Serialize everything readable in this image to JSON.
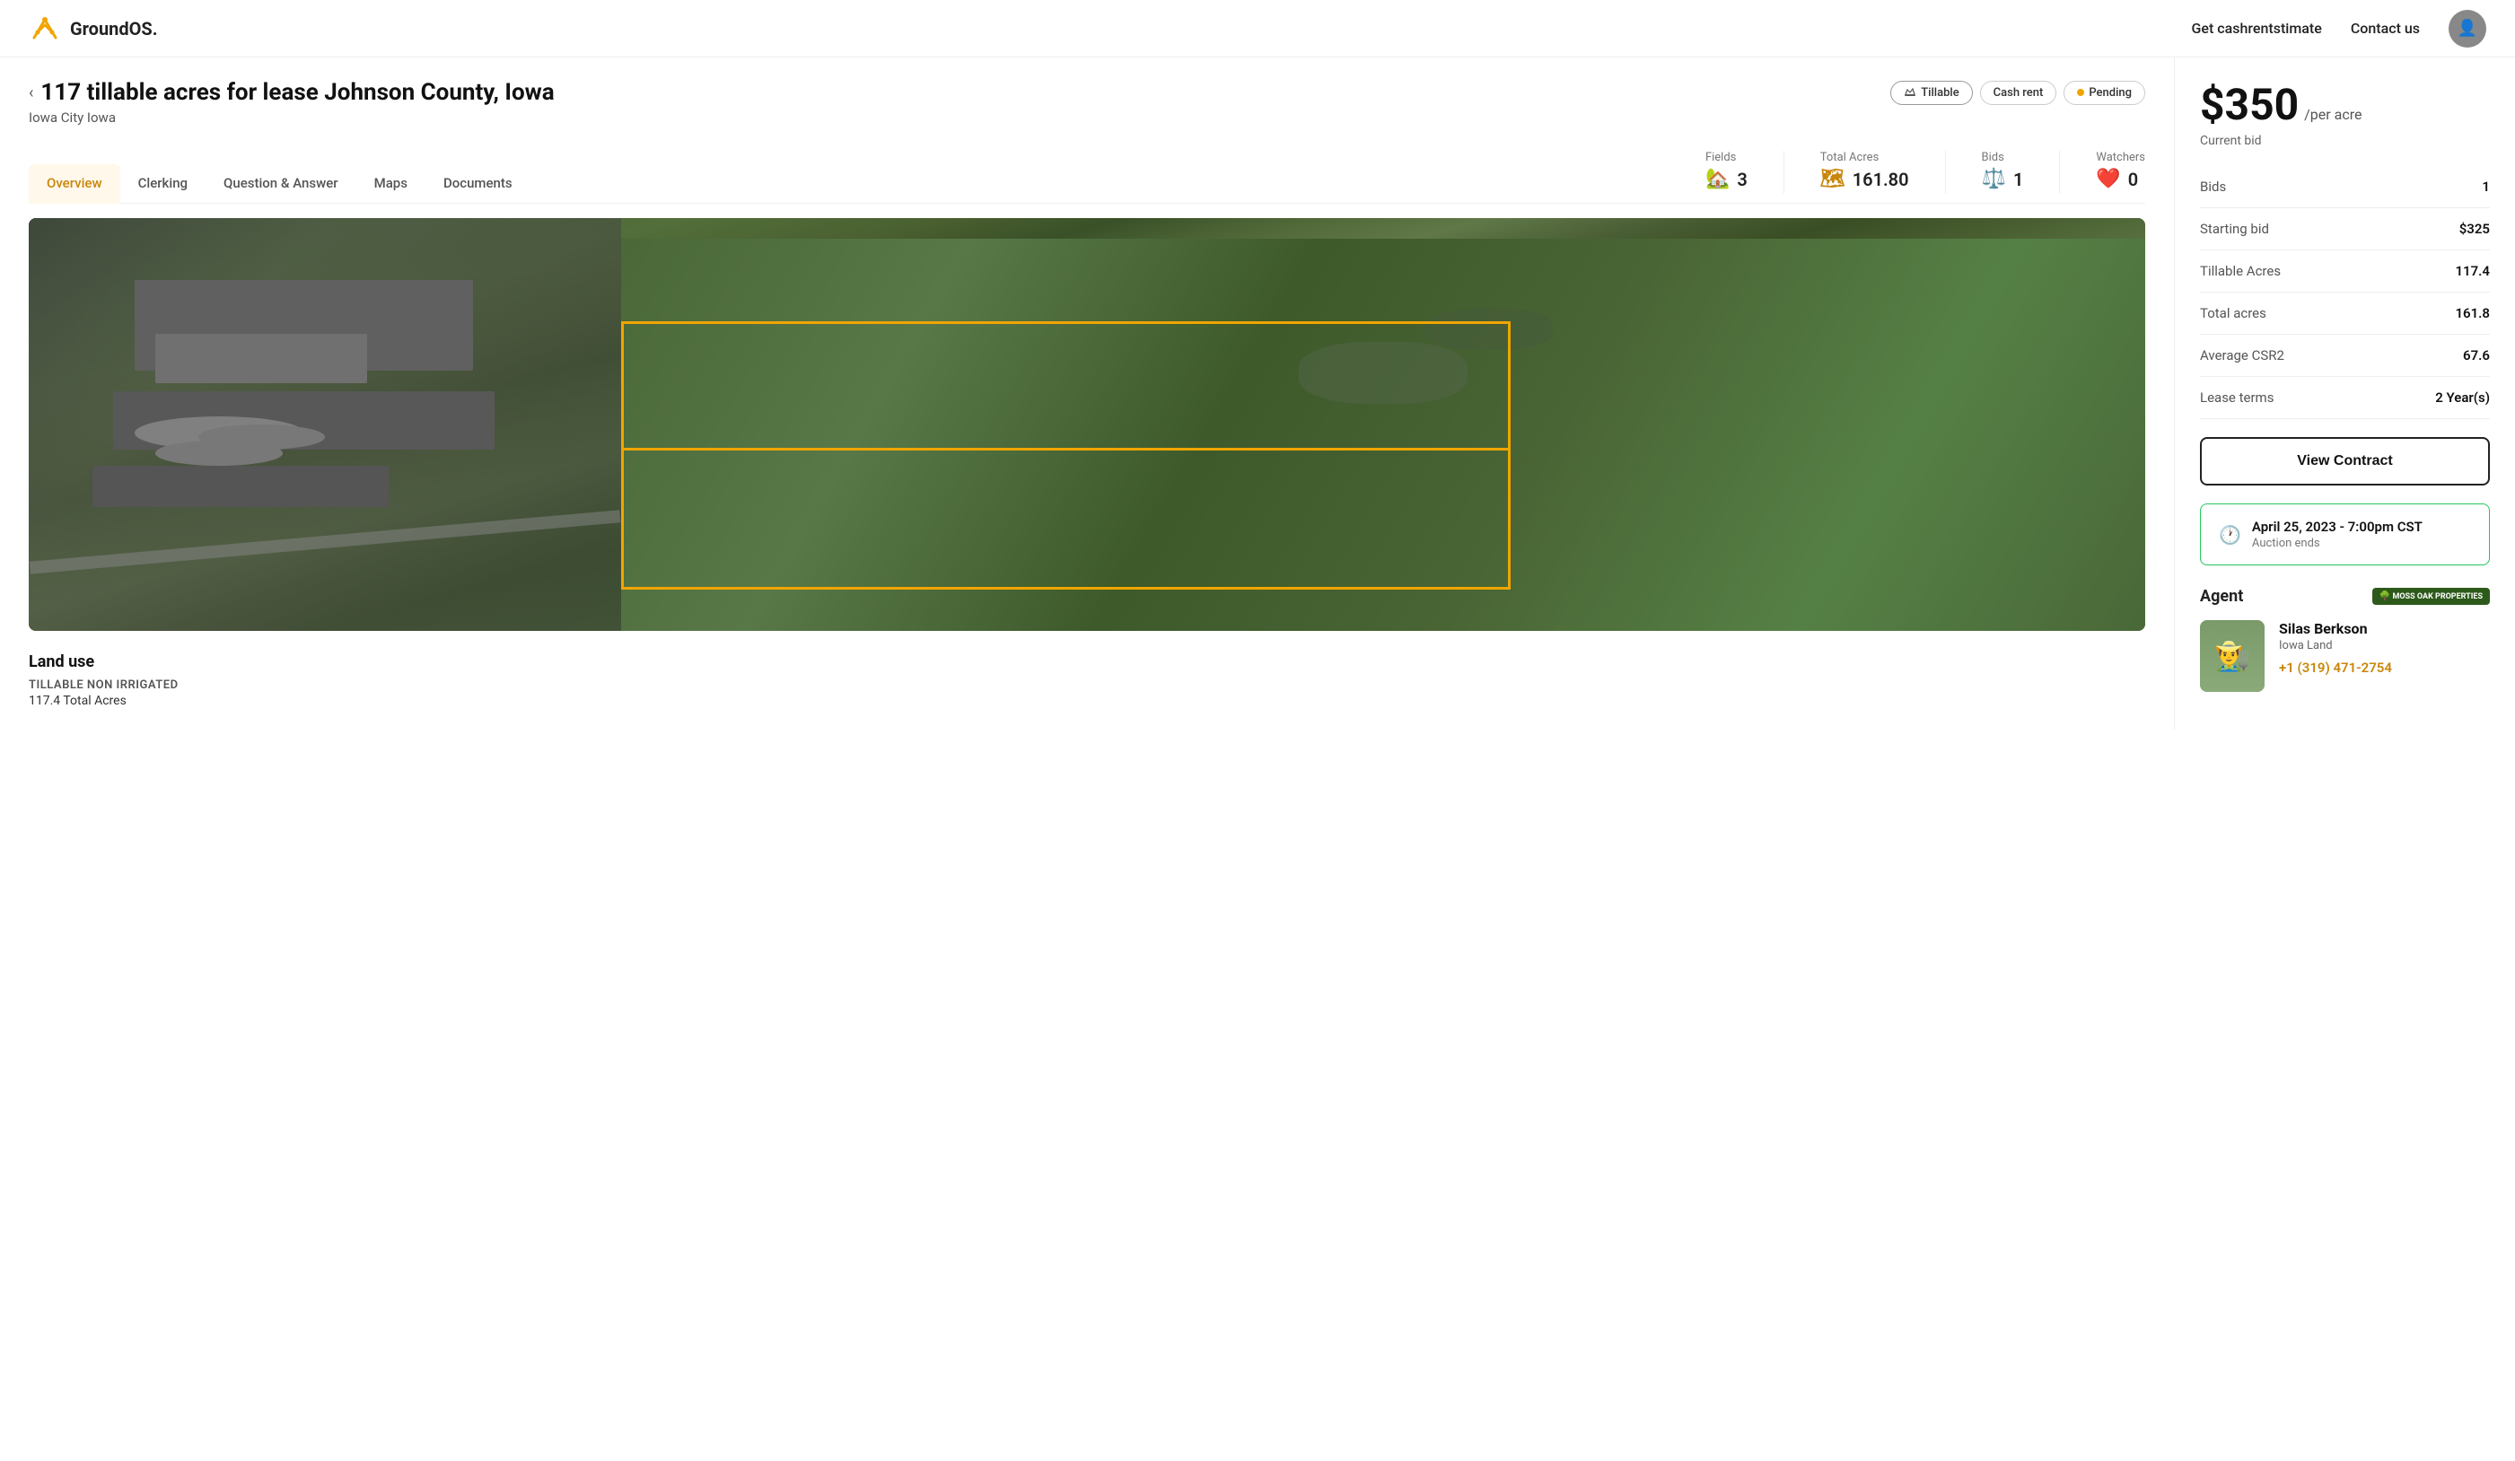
{
  "header": {
    "logo_text": "GroundOS.",
    "nav_cashrent": "Get cashrentstimate",
    "nav_contact": "Contact us"
  },
  "breadcrumb": {
    "back_label": "‹"
  },
  "listing": {
    "title": "117 tillable acres for lease Johnson County, Iowa",
    "subtitle": "Iowa City Iowa",
    "badges": [
      {
        "id": "tillable",
        "label": "Tillable",
        "type": "tillable"
      },
      {
        "id": "cash-rent",
        "label": "Cash rent",
        "type": "cash-rent"
      },
      {
        "id": "pending",
        "label": "Pending",
        "type": "pending",
        "dot": true
      }
    ]
  },
  "tabs": [
    {
      "id": "overview",
      "label": "Overview",
      "active": true
    },
    {
      "id": "clerking",
      "label": "Clerking",
      "active": false
    },
    {
      "id": "qa",
      "label": "Question & Answer",
      "active": false
    },
    {
      "id": "maps",
      "label": "Maps",
      "active": false
    },
    {
      "id": "documents",
      "label": "Documents",
      "active": false
    }
  ],
  "stats": [
    {
      "id": "fields",
      "label": "Fields",
      "value": "3"
    },
    {
      "id": "total-acres",
      "label": "Total Acres",
      "value": "161.80"
    },
    {
      "id": "bids",
      "label": "Bids",
      "value": "1"
    },
    {
      "id": "watchers",
      "label": "Watchers",
      "value": "0"
    }
  ],
  "land_use": {
    "section_title": "Land use",
    "label": "TILLABLE NON IRRIGATED",
    "acres_label": "117.4 Total Acres"
  },
  "bid_panel": {
    "price": "$350",
    "per_acre": "/per acre",
    "current_bid_label": "Current bid",
    "rows": [
      {
        "label": "Bids",
        "value": "1"
      },
      {
        "label": "Starting bid",
        "value": "$325"
      },
      {
        "label": "Tillable Acres",
        "value": "117.4"
      },
      {
        "label": "Total acres",
        "value": "161.8"
      },
      {
        "label": "Average CSR2",
        "value": "67.6"
      },
      {
        "label": "Lease terms",
        "value": "2 Year(s)"
      }
    ],
    "view_contract_label": "View Contract",
    "auction": {
      "date": "April 25, 2023 - 7:00pm CST",
      "ends_label": "Auction ends"
    },
    "agent": {
      "section_title": "Agent",
      "company_label": "MOSS OAK PROPERTIES",
      "name": "Silas Berkson",
      "region": "Iowa Land",
      "phone": "+1 (319) 471-2754"
    }
  }
}
